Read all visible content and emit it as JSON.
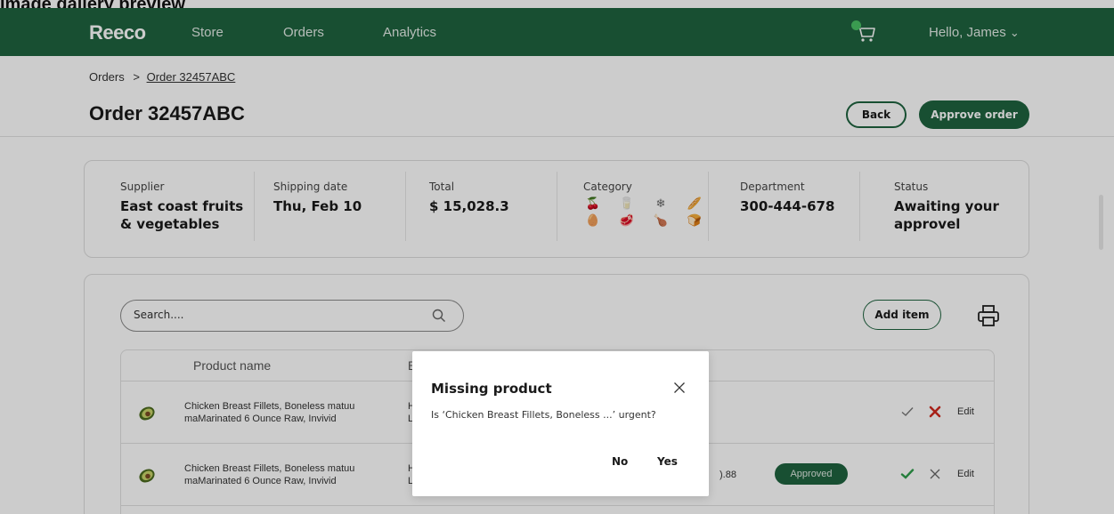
{
  "caption": "Image gallery preview",
  "brand": {
    "logo": "Reeco"
  },
  "nav": {
    "store": "Store",
    "orders": "Orders",
    "analytics": "Analytics"
  },
  "user": {
    "greeting": "Hello, James",
    "chevron": "⌄"
  },
  "breadcrumb": {
    "root": "Orders",
    "separator": ">",
    "current": "Order 32457ABC"
  },
  "page": {
    "title": "Order 32457ABC",
    "back_label": "Back",
    "approve_label": "Approve order"
  },
  "summary": {
    "supplier_label": "Supplier",
    "supplier_line1": "East coast fruits",
    "supplier_line2": "& vegetables",
    "shipping_label": "Shipping date",
    "shipping_value": "Thu, Feb 10",
    "total_label": "Total",
    "total_value": "$ 15,028.3",
    "category_label": "Category",
    "category_icons": [
      "🍒",
      "🥛",
      "❄",
      "🥖",
      "🥚",
      "🥩",
      "🍗",
      "🍞"
    ],
    "department_label": "Department",
    "department_value": "300-444-678",
    "status_label": "Status",
    "status_line1": "Awaiting your",
    "status_line2": "approvel"
  },
  "search": {
    "placeholder": "Search...."
  },
  "toolbar": {
    "add_item": "Add item"
  },
  "table": {
    "col_product": "Product name",
    "col_brand_initial": "B",
    "rows": [
      {
        "name_line1": "Chicken Breast Fillets, Boneless matuu",
        "name_line2": "maMarinated 6 Ounce Raw, Invivid",
        "brand_line1": "H",
        "brand_line2": "L",
        "price": "",
        "status": "",
        "edit": "Edit",
        "state": "missing"
      },
      {
        "name_line1": "Chicken Breast Fillets, Boneless matuu",
        "name_line2": "maMarinated 6 Ounce Raw, Invivid",
        "brand_line1": "H",
        "brand_line2": "L",
        "price": ").88",
        "status": "Approved",
        "edit": "Edit",
        "state": "approved"
      }
    ]
  },
  "modal": {
    "title": "Missing product",
    "message": "Is ‘Chicken Breast Fillets, Boneless ...’ urgent?",
    "no_label": "No",
    "yes_label": "Yes"
  },
  "colors": {
    "brand_green": "#1e633f",
    "danger_red": "#d12a1f",
    "approve_green": "#2f9e4c"
  }
}
